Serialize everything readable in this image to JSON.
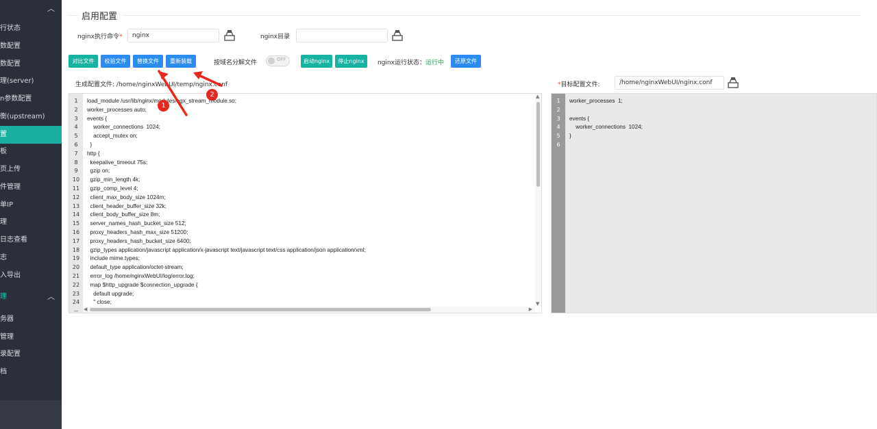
{
  "sidebar": {
    "items": [
      {
        "label": "行状态",
        "active": false
      },
      {
        "label": "数配置",
        "active": false
      },
      {
        "label": "数配置",
        "active": false
      },
      {
        "label": "理(server)",
        "active": false
      },
      {
        "label": "n参数配置",
        "active": false
      },
      {
        "label": "衡(upstream)",
        "active": false
      },
      {
        "label": "置",
        "active": true
      },
      {
        "label": "板",
        "active": false
      },
      {
        "label": "页上传",
        "active": false
      },
      {
        "label": "件管理",
        "active": false
      },
      {
        "label": "单IP",
        "active": false
      },
      {
        "label": "理",
        "active": false
      },
      {
        "label": "日志查看",
        "active": false
      },
      {
        "label": "志",
        "active": false
      },
      {
        "label": "入导出",
        "active": false
      }
    ],
    "group_label": "理",
    "sub_items": [
      {
        "label": "务器"
      },
      {
        "label": "管理"
      },
      {
        "label": "录配置"
      },
      {
        "label": "档"
      }
    ]
  },
  "section": {
    "title": "启用配置"
  },
  "form": {
    "nginx_cmd_label": "nginx执行命令",
    "nginx_cmd_required": "*",
    "nginx_cmd_value": "nginx",
    "nginx_dir_label": "nginx目录",
    "nginx_dir_value": ""
  },
  "toolbar": {
    "compare": "对比文件",
    "validate": "校验文件",
    "replace": "替换文件",
    "reload": "重新装载",
    "split_label": "按域名分解文件",
    "toggle_state": "OFF",
    "start": "启动nginx",
    "stop": "停止nginx",
    "status_label": "nginx运行状态：",
    "status_value": "运行中",
    "restore": "还原文件"
  },
  "colors": {
    "teal": "#16b3a2",
    "blue": "#2d8cf0",
    "status": "#1aa34a",
    "sidebar": "#2b2f3a"
  },
  "generated": {
    "label": "生成配置文件:",
    "path": "/home/nginxWebUI/temp/nginx.conf",
    "lines": [
      "load_module /usr/lib/nginx/modules/ngx_stream_module.so;",
      "worker_processes auto;",
      "events {",
      "    worker_connections  1024;",
      "    accept_mutex on;",
      "  }",
      "http {",
      "  keepalive_timeout 75s;",
      "  gzip on;",
      "  gzip_min_length 4k;",
      "  gzip_comp_level 4;",
      "  client_max_body_size 1024m;",
      "  client_header_buffer_size 32k;",
      "  client_body_buffer_size 8m;",
      "  server_names_hash_bucket_size 512;",
      "  proxy_headers_hash_max_size 51200;",
      "  proxy_headers_hash_bucket_size 6400;",
      "  gzip_types application/javascript application/x-javascript text/javascript text/css application/json application/xml;",
      "  include mime.types;",
      "  default_type application/octet-stream;",
      "  error_log /home/nginxWebUI/log/error.log;",
      "  map $http_upgrade $connection_upgrade {",
      "    default upgrade;",
      "    '' close;"
    ]
  },
  "target": {
    "label": "目标配置文件:",
    "required": "*",
    "path": "/home/nginxWebUI/nginx.conf",
    "lines": [
      "worker_processes  1;",
      "",
      "events {",
      "    worker_connections  1024;",
      "}",
      ""
    ]
  },
  "annotations": {
    "badge1": "1",
    "badge2": "2"
  }
}
